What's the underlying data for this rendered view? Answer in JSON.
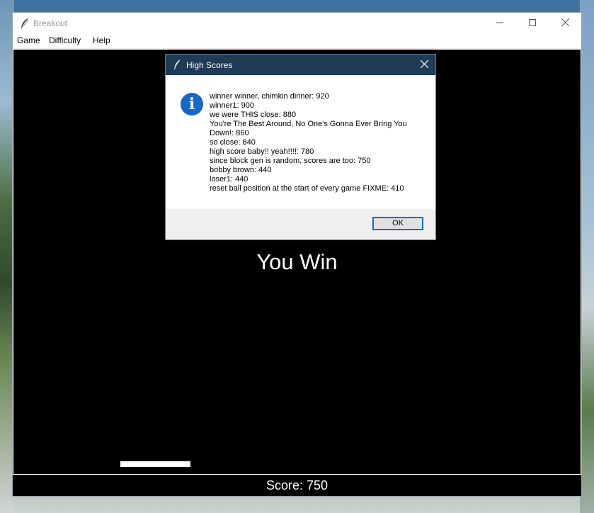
{
  "window": {
    "title": "Breakout",
    "icon": "feather-icon",
    "controls": {
      "minimize": "minimize-icon",
      "maximize": "maximize-icon",
      "close": "close-icon"
    }
  },
  "menu": {
    "items": [
      {
        "label": "Game"
      },
      {
        "label": "Difficulty"
      },
      {
        "label": "Help"
      }
    ]
  },
  "game": {
    "message": "You Win",
    "score_text": "Score: 750",
    "colors": {
      "background": "#000000",
      "paddle": "#ffffff",
      "text": "#ffffff"
    }
  },
  "dialog": {
    "title": "High Scores",
    "icon": "info-icon",
    "info_glyph": "i",
    "scores": [
      "winner winner, chimkin dinner: 920",
      "winner1: 900",
      "we were THIS close: 880",
      "You're The Best Around, No One's Gonna Ever Bring You Down!: 860",
      "so close: 840",
      "high score baby!! yeah!!!!: 780",
      "since block gen is random, scores are too: 750",
      "bobby brown: 440",
      "loser1: 440",
      "reset ball position at the start of every game FIXME: 410"
    ],
    "ok_label": "OK",
    "colors": {
      "titlebar": "#1f3b56",
      "info": "#1668c8",
      "focus": "#0a6fcf"
    }
  }
}
